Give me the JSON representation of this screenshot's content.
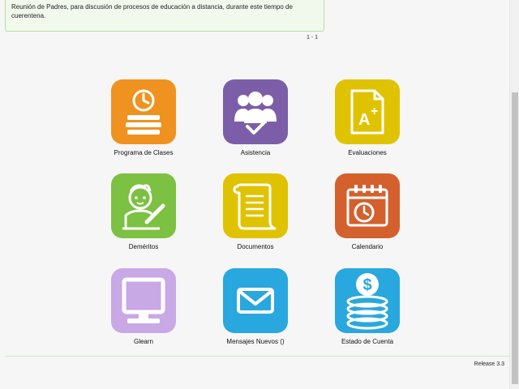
{
  "notice": {
    "text": "Reunión de Padres, para discusión de procesos de educación a distancia, durante este tiempo de cuerentena."
  },
  "pager": "1 - 1",
  "tiles": [
    {
      "label": "Programa de Clases",
      "color": "#f0921f",
      "icon": "clock-books-icon"
    },
    {
      "label": "Asistencia",
      "color": "#7b5ea7",
      "icon": "group-check-icon"
    },
    {
      "label": "Evaluaciones",
      "color": "#e0c300",
      "icon": "grade-doc-icon"
    },
    {
      "label": "Deméritos",
      "color": "#7cc142",
      "icon": "student-writing-icon"
    },
    {
      "label": "Documentos",
      "color": "#e0c300",
      "icon": "scroll-doc-icon"
    },
    {
      "label": "Calendario",
      "color": "#d4602e",
      "icon": "calendar-clock-icon"
    },
    {
      "label": "Glearn",
      "color": "#c9a8e6",
      "icon": "monitor-icon"
    },
    {
      "label": "Mensajes Nuevos ()",
      "color": "#29a7df",
      "icon": "envelope-icon"
    },
    {
      "label": "Estado de Cuenta",
      "color": "#29a7df",
      "icon": "coins-dollar-icon"
    }
  ],
  "footer": {
    "release": "Release 3.3"
  }
}
